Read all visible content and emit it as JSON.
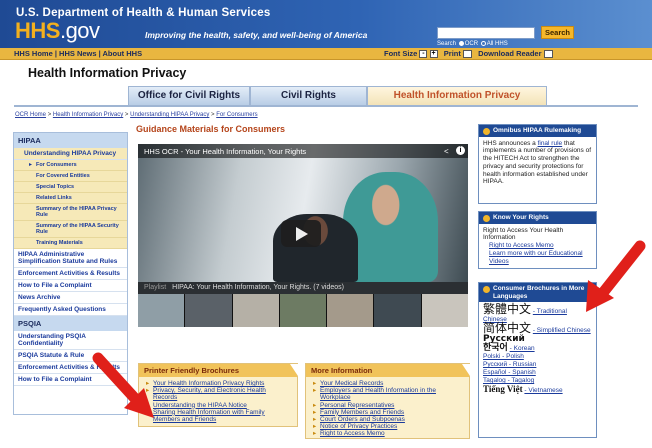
{
  "header": {
    "dept": "U.S. Department of Health & Human Services",
    "logo_main": "HHS",
    "logo_suffix": ".gov",
    "tagline": "Improving the health, safety, and well-being of America",
    "search_button": "Search",
    "search_label": "Search",
    "search_opt1": "OCR",
    "search_opt2": "All HHS"
  },
  "subbar": {
    "links": "HHS Home | HHS News | About HHS",
    "font_size": "Font Size",
    "font_minus": "-",
    "font_plus": "+",
    "print": "Print",
    "download": "Download Reader"
  },
  "page_title": "Health Information Privacy",
  "tabs": [
    "Office for Civil Rights",
    "Civil Rights",
    "Health Information Privacy"
  ],
  "breadcrumb": {
    "items": [
      "OCR Home",
      "Health Information Privacy",
      "Understanding HIPAA Privacy",
      "For Consumers"
    ],
    "sep": ">"
  },
  "leftnav": {
    "head": "HIPAA",
    "item_current": "Understanding HIPAA Privacy",
    "subs": [
      "For Consumers",
      "For Covered Entities",
      "Special Topics",
      "Related Links",
      "Summary of the HIPAA Privacy Rule",
      "Summary of the HIPAA Security Rule",
      "Training Materials"
    ],
    "items": [
      "HIPAA Administrative Simplification Statute and Rules",
      "Enforcement Activities & Results",
      "How to File a Complaint",
      "News Archive",
      "Frequently Asked Questions"
    ],
    "head2": "PSQIA",
    "items2": [
      "Understanding PSQIA Confidentiality",
      "PSQIA Statute & Rule",
      "Enforcement Activities & Results",
      "How to File a Complaint"
    ]
  },
  "main": {
    "section_title": "Guidance Materials for Consumers",
    "video_title": "HHS OCR - Your Health Information, Your Rights",
    "info": "i",
    "playlist_label": "Playlist",
    "playlist_title": "HIPAA: Your Health Information, Your Rights. (7 videos)"
  },
  "printer_box": {
    "head": "Printer Friendly Brochures",
    "items": [
      "Your Health Information Privacy Rights",
      "Privacy, Security, and Electronic Health Records",
      "Understanding the HIPAA Notice",
      "Sharing Health Information with Family Members and Friends"
    ]
  },
  "more_box": {
    "head": "More Information",
    "items": [
      "Your Medical Records",
      "Employers and Health Information in the Workplace",
      "Personal Representatives",
      "Family Members and Friends",
      "Court Orders and Subpoenas",
      "Notice of Privacy Practices",
      "Right to Access Memo"
    ]
  },
  "omnibus": {
    "head": "Omnibus HIPAA Rulemaking",
    "pre": "HHS announces a ",
    "link": "final rule",
    "post": " that implements a number of provisions of the HITECH Act to strengthen the privacy and security protections for health information established under HIPAA."
  },
  "rights": {
    "head": "Know Your Rights",
    "text": "Right to Access Your Health Information",
    "links": [
      "Right to Access Memo",
      "Learn more with our Educational Videos"
    ]
  },
  "langs": {
    "head": "Consumer Brochures in More Languages",
    "items": [
      {
        "script": "繁體中文",
        "label": "- Traditional Chinese"
      },
      {
        "script": "简体中文",
        "label": "- Simplified Chinese"
      },
      {
        "script": "Русский",
        "label": ""
      },
      {
        "script": "한국어",
        "label": "- Korean"
      },
      {
        "script": "",
        "label": "Polski - Polish"
      },
      {
        "script": "",
        "label": "Pусский - Russian"
      },
      {
        "script": "",
        "label": "Español - Spanish"
      },
      {
        "script": "",
        "label": "Tagalog - Tagalog"
      },
      {
        "script": "Tiếng Việt",
        "label": "- Vietnamese"
      }
    ]
  },
  "colors": {
    "header_blue": "#1f4a94",
    "gold": "#e9b640",
    "accent_orange": "#b5451b",
    "arrow_red": "#e0201a"
  }
}
